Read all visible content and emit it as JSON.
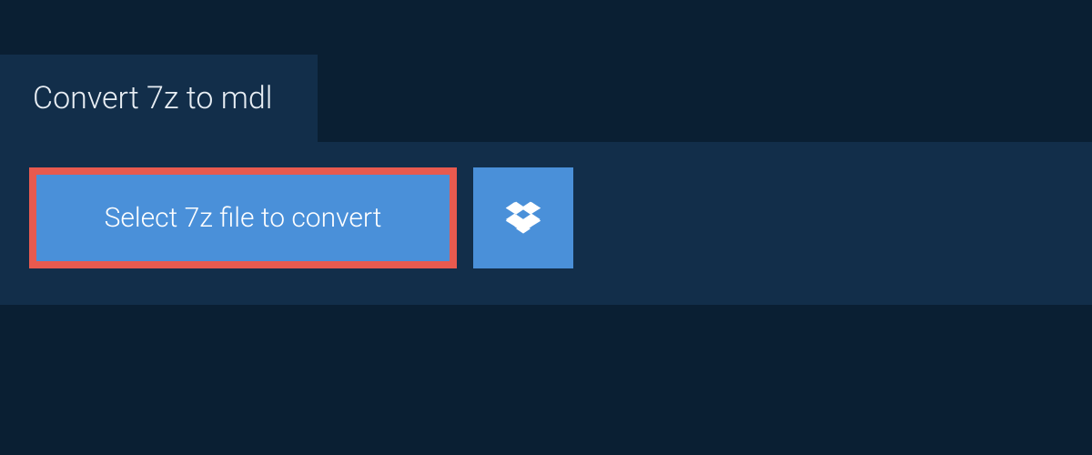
{
  "tab": {
    "title": "Convert 7z to mdl"
  },
  "buttons": {
    "select_label": "Select 7z file to convert"
  },
  "colors": {
    "background_dark": "#0a1f33",
    "panel": "#122e4a",
    "button_blue": "#4a90d9",
    "highlight_border": "#e85a4f",
    "text_light": "#e8eef4"
  }
}
